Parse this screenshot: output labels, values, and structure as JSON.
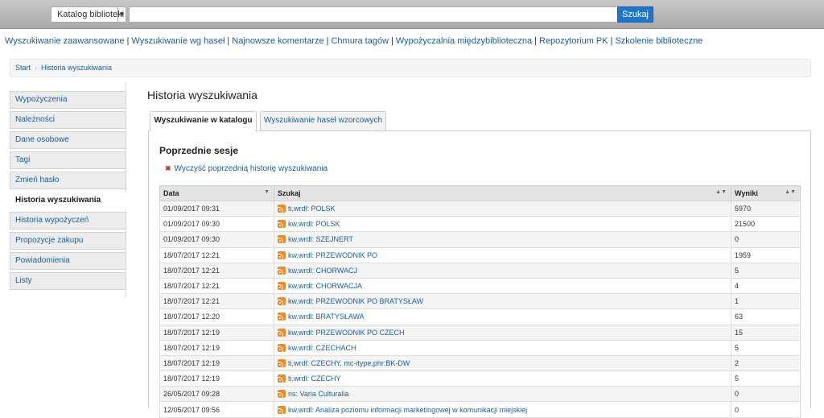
{
  "header": {
    "scope_label": "Katalog biblioteki",
    "search_value": "",
    "search_button": "Szukaj"
  },
  "nav": [
    "Wyszukiwanie zaawansowane",
    "Wyszukiwanie wg haseł",
    "Najnowsze komentarze",
    "Chmura tagów",
    "Wypożyczalnia międzybiblioteczna",
    "Repozytorium PK",
    "Szkolenie biblioteczne"
  ],
  "breadcrumb": {
    "start": "Start",
    "current": "Historia wyszukiwania"
  },
  "sidebar": [
    "Wypożyczenia",
    "Należności",
    "Dane osobowe",
    "Tagi",
    "Zmień hasło",
    "Historia wyszukiwania",
    "Historia wypożyczeń",
    "Propozycje zakupu",
    "Powiadomienia",
    "Listy"
  ],
  "page": {
    "title": "Historia wyszukiwania",
    "tabs": [
      "Wyszukiwanie w katalogu",
      "Wyszukiwanie haseł wzorcowych"
    ],
    "section_title": "Poprzednie sesje",
    "clear_link": "Wyczyść poprzednią historię wyszukiwania"
  },
  "table": {
    "headers": [
      "Data",
      "Szukaj",
      "Wyniki"
    ],
    "rows": [
      [
        "01/09/2017 09:31",
        "ti,wrdl: POLSK",
        "5970"
      ],
      [
        "01/09/2017 09:30",
        "kw,wrdl: POLSK",
        "21500"
      ],
      [
        "01/09/2017 09:30",
        "kw,wrdl: SZEJNERT",
        "0"
      ],
      [
        "18/07/2017 12:21",
        "kw,wrdl: PRZEWODNIK PO",
        "1959"
      ],
      [
        "18/07/2017 12:21",
        "kw,wrdl: CHORWACJ",
        "5"
      ],
      [
        "18/07/2017 12:21",
        "kw,wrdl: CHORWACJA",
        "4"
      ],
      [
        "18/07/2017 12:21",
        "kw,wrdl: PRZEWODNIK PO BRATYSŁAW",
        "1"
      ],
      [
        "18/07/2017 12:20",
        "kw,wrdl: BRATYSŁAWA",
        "63"
      ],
      [
        "18/07/2017 12:19",
        "kw,wrdl: PRZEWODNIK PO CZECH",
        "15"
      ],
      [
        "18/07/2017 12:19",
        "kw,wrdl: CZECHACH",
        "5"
      ],
      [
        "18/07/2017 12:19",
        "ti,wrdl: CZECHY, mc-itype,phr:BK-DW",
        "2"
      ],
      [
        "18/07/2017 12:19",
        "ti,wrdl: CZECHY",
        "5"
      ],
      [
        "26/05/2017 09:28",
        "ns: Varia Culturalia",
        "0"
      ],
      [
        "12/05/2017 09:56",
        "kw,wrdl: Analiza poziomu informacji marketingowej w komunikacji miejskiej",
        "0"
      ]
    ]
  }
}
